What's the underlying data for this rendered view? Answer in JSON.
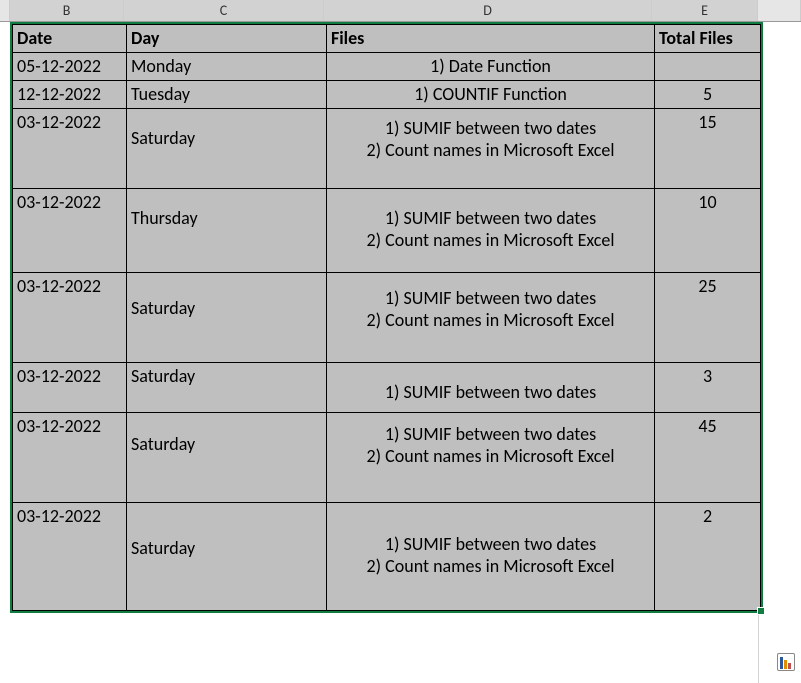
{
  "columns": {
    "B": "B",
    "C": "C",
    "D": "D",
    "E": "E"
  },
  "headers": {
    "date": "Date",
    "day": "Day",
    "files": "Files",
    "total": "Total Files"
  },
  "rows": [
    {
      "date": "05-12-2022",
      "day": "Monday",
      "files": "1) Date Function",
      "total": ""
    },
    {
      "date": "12-12-2022",
      "day": "Tuesday",
      "files": "1) COUNTIF Function",
      "total": "5"
    },
    {
      "date": "03-12-2022",
      "day": "Saturday",
      "files": "1) SUMIF between two dates\n2) Count names in Microsoft Excel",
      "total": "15"
    },
    {
      "date": "03-12-2022",
      "day": "Thursday",
      "files": "1) SUMIF between two dates\n2) Count names in Microsoft Excel",
      "total": "10"
    },
    {
      "date": "03-12-2022",
      "day": "Saturday",
      "files": "1) SUMIF between two dates\n2) Count names in Microsoft Excel",
      "total": "25"
    },
    {
      "date": "03-12-2022",
      "day": "Saturday",
      "files": "1) SUMIF between two dates",
      "total": "3"
    },
    {
      "date": "03-12-2022",
      "day": "Saturday",
      "files": "1) SUMIF between two dates\n2) Count names in Microsoft Excel",
      "total": "45"
    },
    {
      "date": "03-12-2022",
      "day": "Saturday",
      "files": "1) SUMIF between two dates\n2) Count names in Microsoft Excel",
      "total": "2"
    }
  ],
  "chart_data": {
    "type": "table",
    "title": "",
    "columns": [
      "Date",
      "Day",
      "Files",
      "Total Files"
    ],
    "data": [
      [
        "05-12-2022",
        "Monday",
        "1) Date Function",
        null
      ],
      [
        "12-12-2022",
        "Tuesday",
        "1) COUNTIF Function",
        5
      ],
      [
        "03-12-2022",
        "Saturday",
        "1) SUMIF between two dates\n2) Count names in Microsoft Excel",
        15
      ],
      [
        "03-12-2022",
        "Thursday",
        "1) SUMIF between two dates\n2) Count names in Microsoft Excel",
        10
      ],
      [
        "03-12-2022",
        "Saturday",
        "1) SUMIF between two dates\n2) Count names in Microsoft Excel",
        25
      ],
      [
        "03-12-2022",
        "Saturday",
        "1) SUMIF between two dates",
        3
      ],
      [
        "03-12-2022",
        "Saturday",
        "1) SUMIF between two dates\n2) Count names in Microsoft Excel",
        45
      ],
      [
        "03-12-2022",
        "Saturday",
        "1) SUMIF between two dates\n2) Count names in Microsoft Excel",
        2
      ]
    ]
  }
}
